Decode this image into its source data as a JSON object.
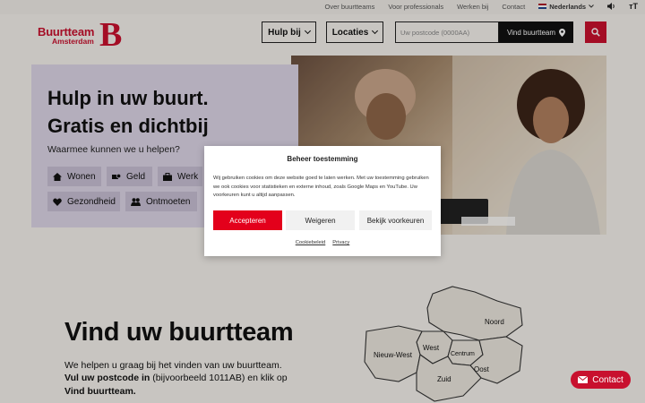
{
  "topbar": {
    "links": [
      "Over buurtteams",
      "Voor professionals",
      "Werken bij",
      "Contact"
    ],
    "language": "Nederlands"
  },
  "header": {
    "logo_line1": "Buurtteam",
    "logo_line2": "Amsterdam",
    "logo_mark": "B",
    "nav_help": "Hulp bij",
    "nav_locations": "Locaties",
    "postcode_placeholder": "Uw postcode (0000AA)",
    "find_button": "Vind buurtteam"
  },
  "hero": {
    "title_line1": "Hulp in uw buurt.",
    "title_line2": "Gratis en dichtbij",
    "question": "Waarmee kunnen we u helpen?",
    "chips": [
      {
        "label": "Wonen",
        "icon": "house-icon"
      },
      {
        "label": "Geld",
        "icon": "money-icon"
      },
      {
        "label": "Werk",
        "icon": "briefcase-icon"
      },
      {
        "label": "Gezondheid",
        "icon": "heart-icon"
      },
      {
        "label": "Ontmoeten",
        "icon": "people-icon"
      }
    ]
  },
  "section": {
    "title": "Vind uw buurtteam",
    "p1": "We helpen u graag bij het vinden van uw buurtteam.",
    "p2_bold1": "Vul uw postcode in",
    "p2_normal": " (bijvoorbeeld 1011AB) en klik op ",
    "p2_bold2": "Vind buurtteam."
  },
  "map": {
    "regions": [
      "Noord",
      "West",
      "Nieuw-West",
      "Centrum",
      "Oost",
      "Zuid"
    ]
  },
  "contact_button": "Contact",
  "cookie_modal": {
    "title": "Beheer toestemming",
    "text": "Wij gebruiken cookies om deze website goed te laten werken. Met uw toestemming gebruiken we ook cookies voor statistieken en externe inhoud, zoals Google Maps en YouTube. Uw voorkeuren kunt u altijd aanpassen.",
    "accept": "Accepteren",
    "deny": "Weigeren",
    "preferences": "Bekijk voorkeuren",
    "link_cookie": "Cookiebeleid",
    "link_privacy": "Privacy"
  },
  "colors": {
    "brand_red": "#c8102e",
    "accept_red": "#e3001b",
    "hero_card": "#dcd5e6",
    "background": "#f4f1ec"
  }
}
